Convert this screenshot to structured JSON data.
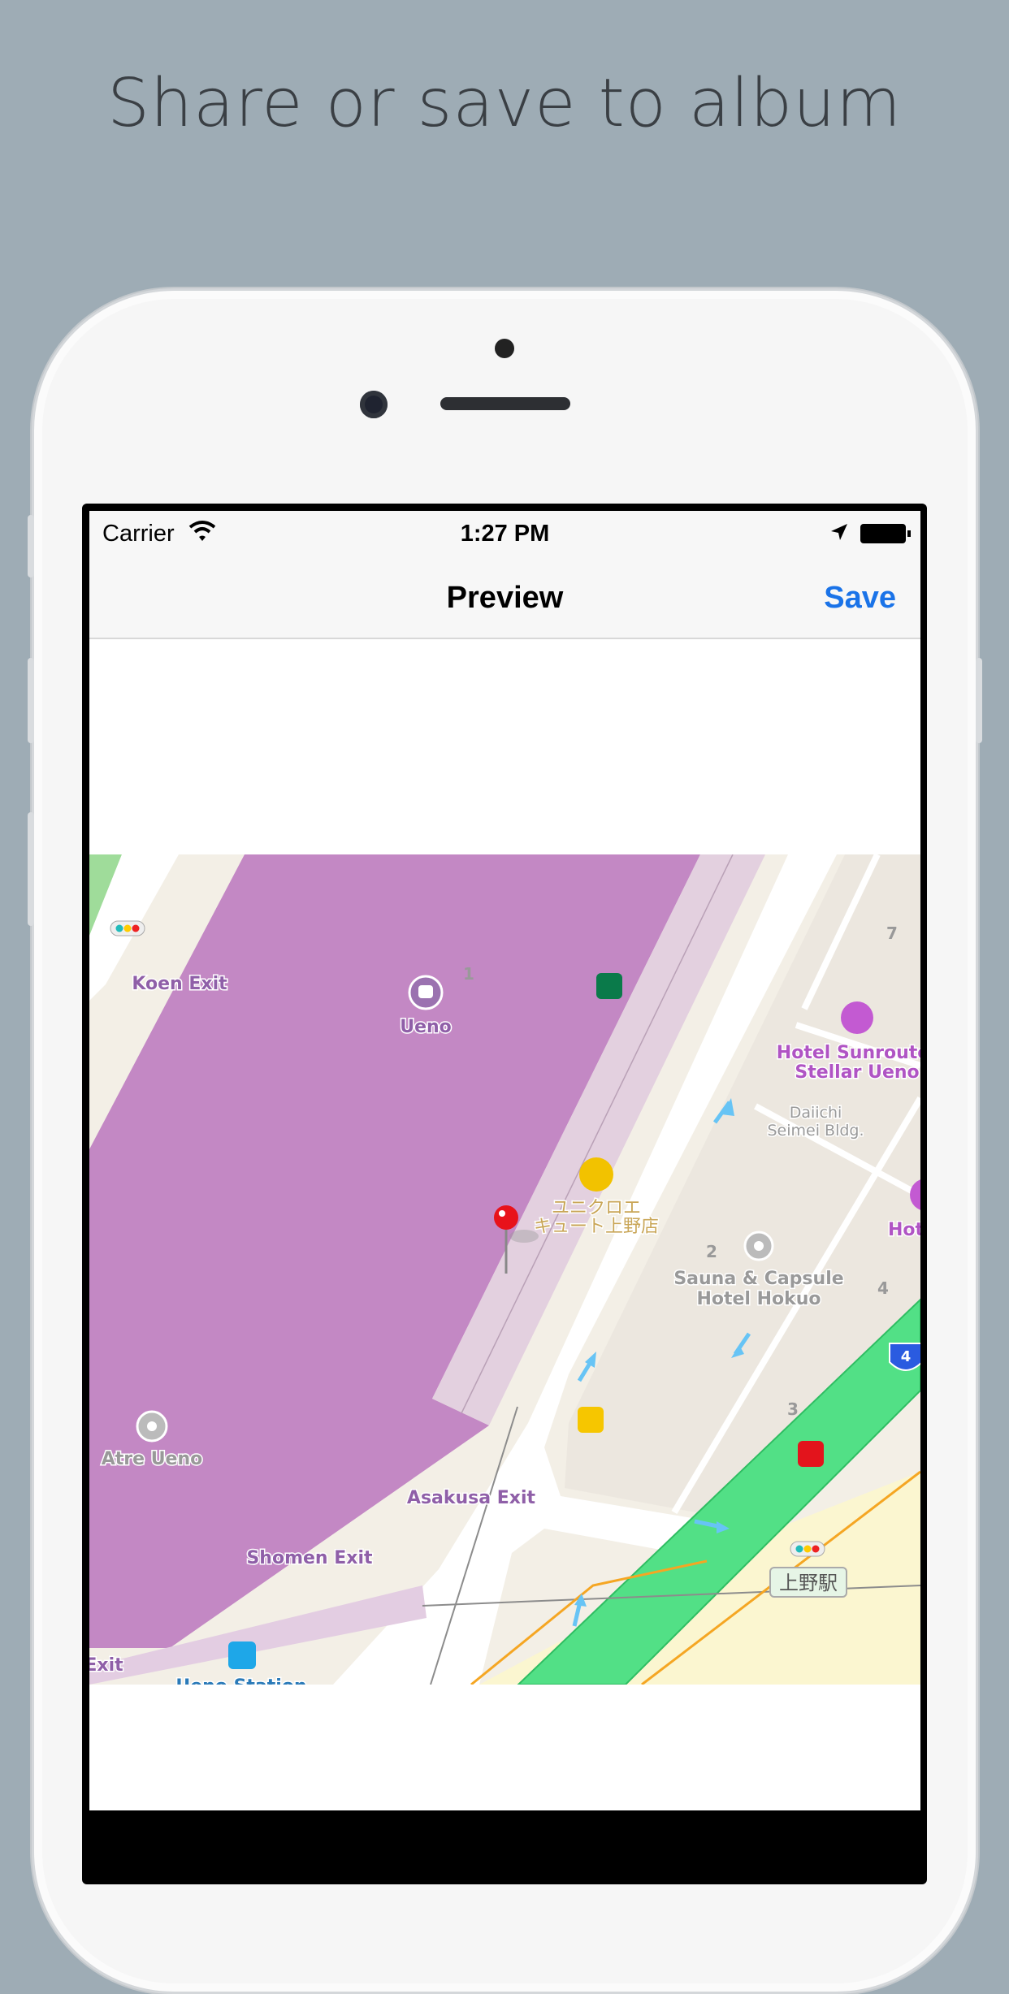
{
  "headline": "Share or save to album",
  "status_bar": {
    "carrier": "Carrier",
    "time": "1:27 PM"
  },
  "nav": {
    "title": "Preview",
    "save_label": "Save"
  },
  "colors": {
    "accent": "#1a73e8",
    "station_area": "#c388c4",
    "rail": "#52e086",
    "background": "#9eacb5"
  },
  "map": {
    "labels": {
      "koen_exit": "Koen Exit",
      "ueno": "Ueno",
      "block_1": "1",
      "block_2": "2",
      "block_3": "3",
      "block_4": "4",
      "block_7": "7",
      "hotel_sunroute_1": "Hotel Sunroute",
      "hotel_sunroute_2": "Stellar Ueno",
      "daiichi_1": "Daiichi",
      "daiichi_2": "Seimei Bldg.",
      "uniqlo_1": "ユニクロエ",
      "uniqlo_2": "キュート上野店",
      "hotel_partial": "Hotel I",
      "sauna_1": "Sauna & Capsule",
      "sauna_2": "Hotel Hokuo",
      "route_4": "4",
      "atre": "Atre Ueno",
      "asakusa_exit": "Asakusa Exit",
      "shomen_exit": "Shomen Exit",
      "ueno_eki": "上野駅",
      "exit": "Exit",
      "ueno_station": "Ueno Station"
    }
  }
}
